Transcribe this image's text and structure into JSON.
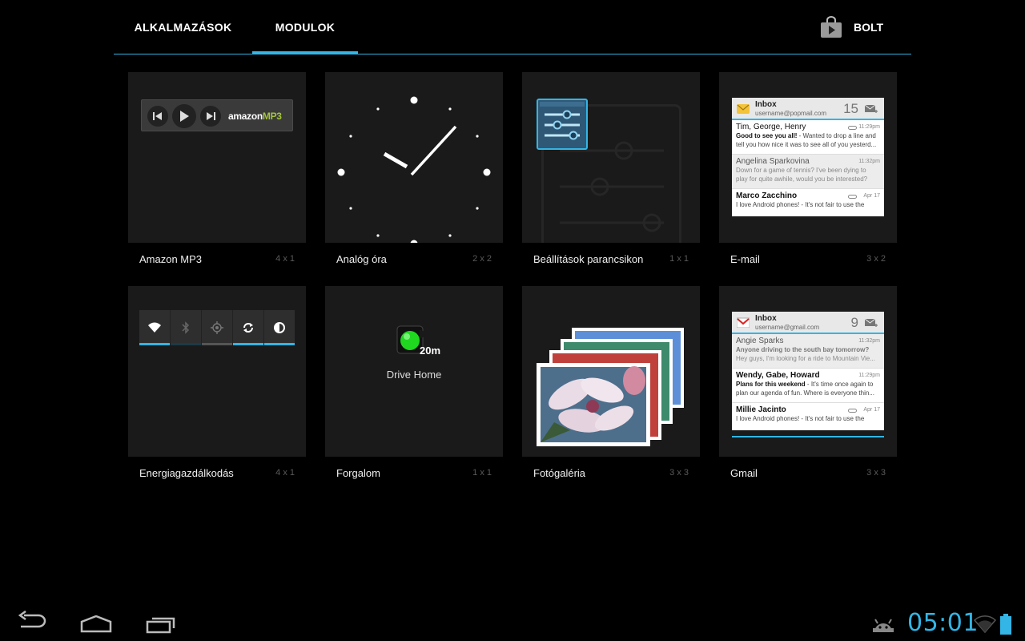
{
  "tabs": {
    "apps_label": "ALKALMAZÁSOK",
    "widgets_label": "MODULOK",
    "store_label": "BOLT"
  },
  "widgets": [
    {
      "name": "Amazon MP3",
      "dims": "4 x 1"
    },
    {
      "name": "Analóg óra",
      "dims": "2 x 2"
    },
    {
      "name": "Beállítások parancsikon",
      "dims": "1 x 1"
    },
    {
      "name": "E-mail",
      "dims": "3 x 2"
    },
    {
      "name": "Energiagazdálkodás",
      "dims": "4 x 1"
    },
    {
      "name": "Forgalom",
      "dims": "1 x 1"
    },
    {
      "name": "Fotógaléria",
      "dims": "3 x 3"
    },
    {
      "name": "Gmail",
      "dims": "3 x 3"
    }
  ],
  "amazon_preview": {
    "logo_text": "amazon",
    "logo_suffix": "MP3"
  },
  "email_preview": {
    "title": "Inbox",
    "account": "username@popmail.com",
    "count": "15",
    "rows": [
      {
        "from": "Tim, George, Henry",
        "time": "11:29pm",
        "snippet_bold": "Good to see you all!",
        "snippet": " - Wanted to drop a line and",
        "snippet2": "tell you how nice it was to see all of you yesterd..."
      },
      {
        "from": "Angelina Sparkovina",
        "time": "11:32pm",
        "snippet_bold": "",
        "snippet": "Down for a game of tennis? I've been dying to",
        "snippet2": "play for quite awhile, would you be interested?"
      },
      {
        "from": "Marco Zacchino",
        "time": "Apr 17",
        "snippet_bold": "",
        "snippet": "I love Android phones! - It's not fair to use the",
        "snippet2": ""
      }
    ]
  },
  "gmail_preview": {
    "title": "Inbox",
    "account": "username@gmail.com",
    "count": "9",
    "rows": [
      {
        "from": "Angie Sparks",
        "time": "11:32pm",
        "snippet_bold": "Anyone driving to the south bay tomorrow?",
        "snippet": "",
        "snippet2": "Hey guys, I'm looking for a ride to Mountain Vie..."
      },
      {
        "from": "Wendy, Gabe, Howard",
        "time": "11:29pm",
        "snippet_bold": "Plans for this weekend",
        "snippet": " - It's time once again to",
        "snippet2": "plan our agenda of fun. Where is everyone thin..."
      },
      {
        "from": "Millie Jacinto",
        "time": "Apr 17",
        "snippet_bold": "",
        "snippet": "I love Android phones! - It's not fair to use the",
        "snippet2": ""
      }
    ]
  },
  "traffic_preview": {
    "time": "20m",
    "label": "Drive Home"
  },
  "status": {
    "time": "05:01"
  },
  "colors": {
    "accent": "#33b5e5",
    "background": "#000000",
    "tile": "#1a1a1a"
  },
  "icons": [
    "store-bag-icon",
    "back-icon",
    "home-icon",
    "recent-apps-icon",
    "android-debug-icon",
    "wifi-icon",
    "battery-icon"
  ]
}
